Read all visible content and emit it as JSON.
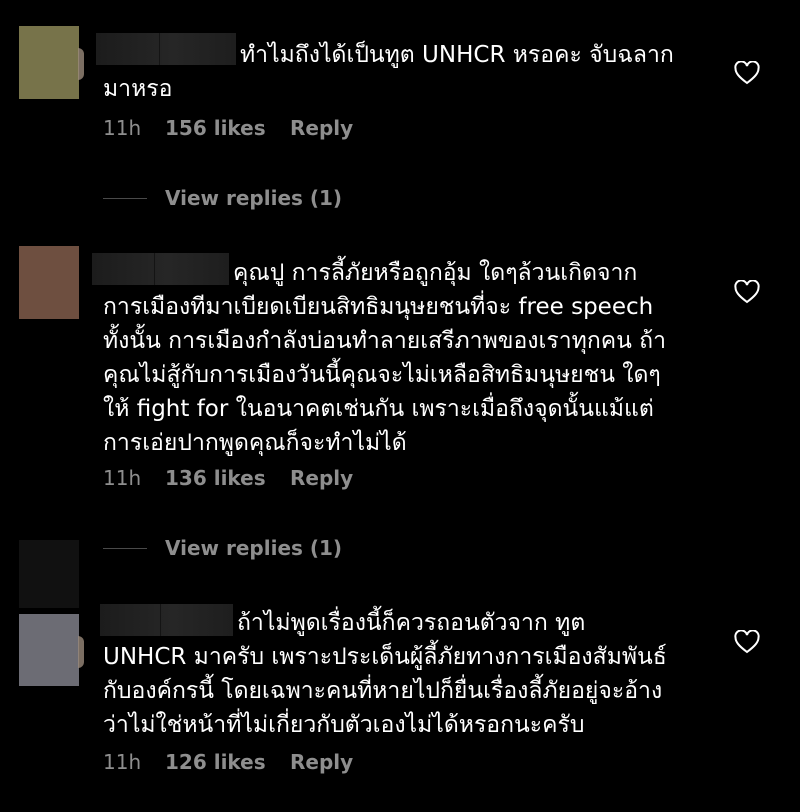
{
  "comments": [
    {
      "text": "ทำไมถึงได้เป็นทูต UNHCR หรอคะ จับฉลาก\nมาหรอ",
      "time": "11h",
      "likes": "156 likes",
      "reply": "Reply",
      "avatar_color": "#77734a",
      "view_replies": "View replies (1)"
    },
    {
      "text": "คุณปู การลี้ภัยหรือถูกอุ้ม ใดๆล้วนเกิดจาก\nการเมืองทีมาเบียดเบียนสิทธิมนุษยชนที่จะ free speech\nทั้งนั้น การเมืองกำลังบ่อนทำลายเสรีภาพของเราทุกคน ถ้า\nคุณไม่สู้กับการเมืองวันนี้คุณจะไม่เหลือสิทธิมนุษยชน ใดๆ\nให้ fight for ในอนาคตเช่นกัน เพราะเมื่อถึงจุดนั้นแม้แต่\nการเอ่ยปากพูดคุณก็จะทำไม่ได้",
      "time": "11h",
      "likes": "136 likes",
      "reply": "Reply",
      "avatar_color": "#6e4f40",
      "view_replies": "View replies (1)"
    },
    {
      "text": "ถ้าไม่พูดเรื่องนี้ก็ควรถอนตัวจาก ทูต\nUNHCR มาครับ เพราะประเด็นผู้ลี้ภัยทางการเมืองสัมพันธ์\nกับองค์กรนี้ โดยเฉพาะคนที่หายไปก็ยื่นเรื่องลี้ภัยอยู่จะอ้าง\nว่าไม่ใช่หน้าที่ไม่เกี่ยวกับตัวเองไม่ได้หรอกนะครับ",
      "time": "11h",
      "likes": "126 likes",
      "reply": "Reply",
      "avatar_color": "#6c6c74"
    }
  ],
  "icons": {
    "like": "heart-outline-icon"
  },
  "colors": {
    "background": "#000000",
    "text": "#ffffff",
    "meta": "#8e8e8e"
  }
}
